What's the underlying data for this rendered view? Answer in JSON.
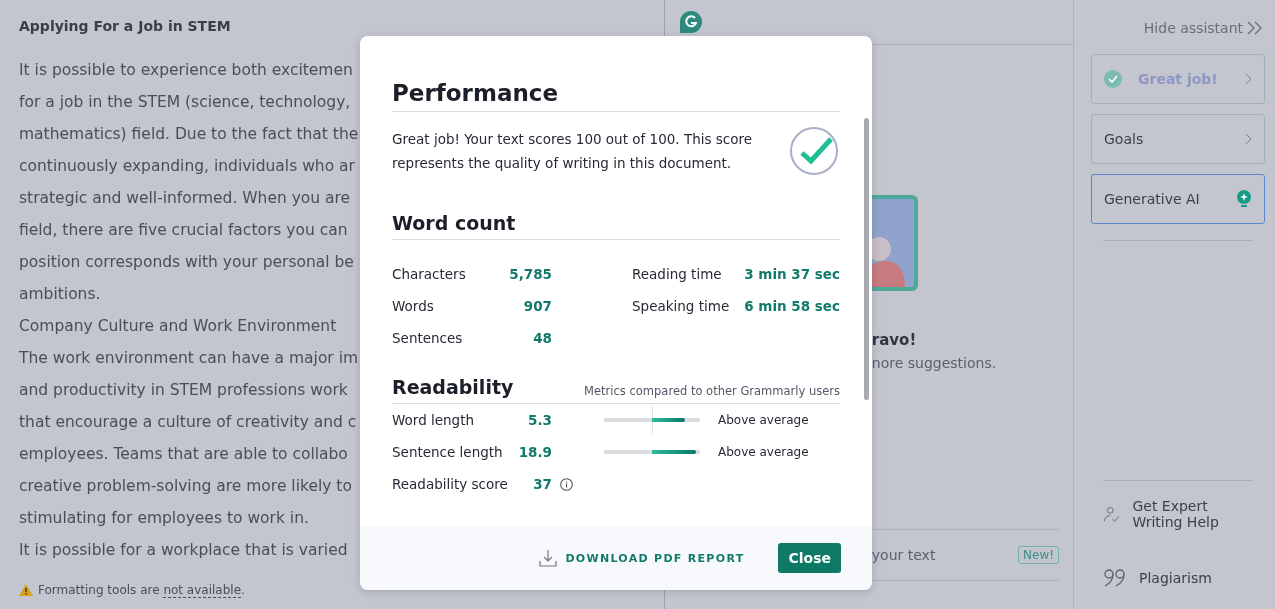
{
  "document": {
    "title": "Applying For a Job in STEM",
    "lines": [
      "It is possible to experience both excitemen",
      "for a job in the STEM (science, technology,",
      "mathematics) field. Due to the fact that the",
      "continuously expanding, individuals who ar",
      "strategic and well-informed. When you are",
      "field, there are five crucial factors you can",
      "position corresponds with your personal be",
      "ambitions.",
      "Company Culture and Work Environment",
      "The work environment can have a major im",
      "and productivity in STEM professions work",
      "that encourage a culture of creativity and c",
      "employees. Teams that are able to collabo",
      "creative problem-solving are more likely to",
      "stimulating for employees to work in.",
      "It is possible for a workplace that is varied"
    ],
    "notice": {
      "text": "Formatting tools are",
      "link": "not available",
      "end": "."
    }
  },
  "assistant": {
    "heading": "ravo!",
    "subtext": "nore suggestions.",
    "prompt_hint": "your text",
    "badge": "New!"
  },
  "sidebar": {
    "hide_label": "Hide assistant",
    "cards": [
      {
        "kind": "status",
        "label": "Great job!"
      },
      {
        "kind": "nav",
        "label": "Goals"
      },
      {
        "kind": "ai",
        "label": "Generative AI"
      }
    ],
    "tools": [
      {
        "kind": "expert",
        "label": "Get Expert Writing Help"
      },
      {
        "kind": "plagiarism",
        "label": "Plagiarism"
      }
    ]
  },
  "modal": {
    "title": "Performance",
    "summary": "Great job! Your text scores 100 out of 100. This score represents the quality of writing in this document.",
    "word_count": {
      "title": "Word count",
      "left": [
        {
          "label": "Characters",
          "value": "5,785"
        },
        {
          "label": "Words",
          "value": "907"
        },
        {
          "label": "Sentences",
          "value": "48"
        }
      ],
      "right": [
        {
          "label": "Reading time",
          "value": "3 min 37 sec"
        },
        {
          "label": "Speaking time",
          "value": "6 min 58 sec"
        }
      ]
    },
    "readability": {
      "title": "Readability",
      "note": "Metrics compared to other Grammarly users",
      "metrics": [
        {
          "label": "Word length",
          "value": "5.3",
          "level": 0.84,
          "rating": "Above average"
        },
        {
          "label": "Sentence length",
          "value": "18.9",
          "level": 0.96,
          "rating": "Above average"
        }
      ],
      "score": {
        "label": "Readability score",
        "value": "37"
      }
    },
    "download": "DOWNLOAD PDF REPORT",
    "close": "Close"
  }
}
